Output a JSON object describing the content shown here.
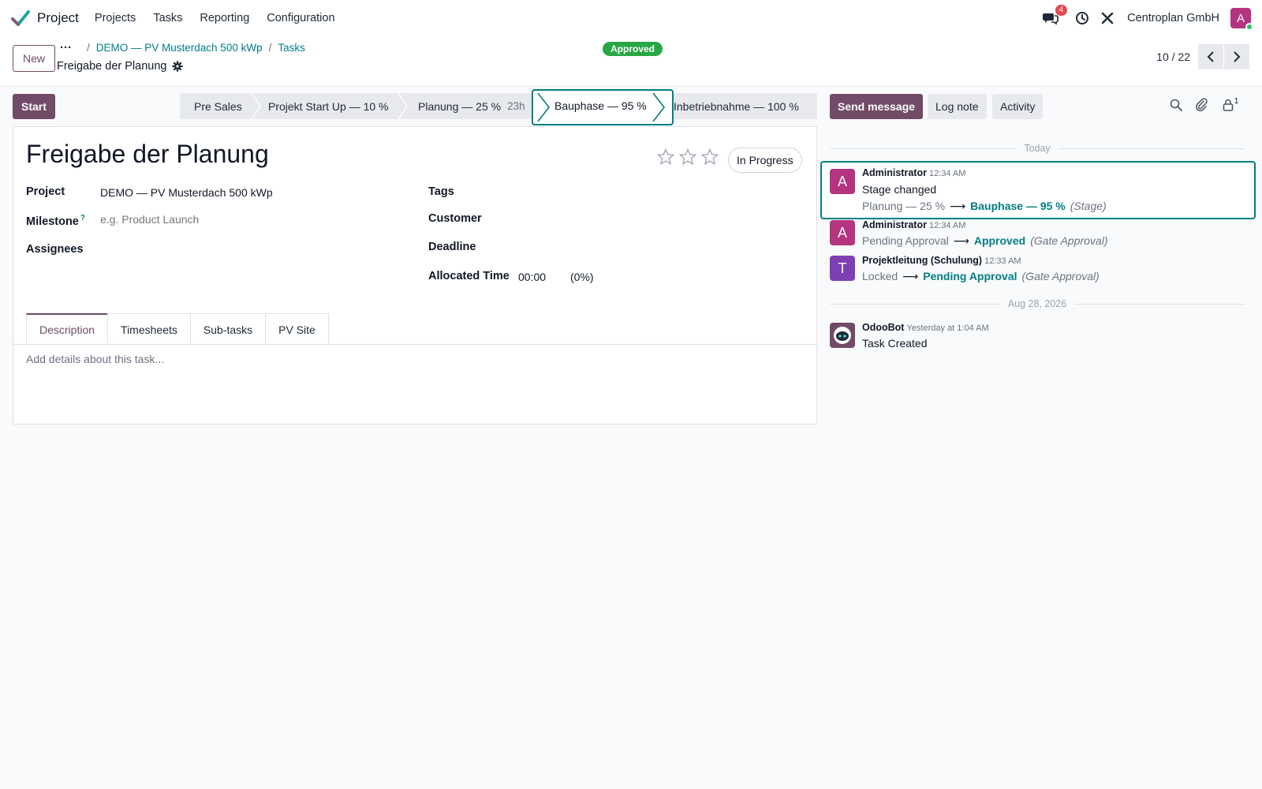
{
  "app": {
    "name": "Project",
    "menu": [
      "Projects",
      "Tasks",
      "Reporting",
      "Configuration"
    ],
    "company": "Centroplan GmbH",
    "user_initial": "A",
    "message_count": "4"
  },
  "control": {
    "new_label": "New",
    "dots": "···",
    "breadcrumb": [
      "DEMO — PV Musterdach 500 kWp",
      "Tasks"
    ],
    "record_title": "Freigabe der Planung",
    "approval_badge": "Approved",
    "pager": "10 / 22"
  },
  "statusbar": {
    "start_label": "Start",
    "stages": [
      {
        "label": "Pre Sales",
        "sub": ""
      },
      {
        "label": "Projekt Start Up — 10 %",
        "sub": ""
      },
      {
        "label": "Planung — 25 %",
        "sub": "23h"
      },
      {
        "label": "Bauphase — 95 %",
        "sub": ""
      },
      {
        "label": "Inbetriebnahme — 100 %",
        "sub": ""
      }
    ],
    "current_index": 3
  },
  "form": {
    "name": "Freigabe der Planung",
    "priority_stars": 3,
    "priority_filled": 0,
    "state": "In Progress",
    "fields": {
      "project_label": "Project",
      "project_value": "DEMO — PV Musterdach 500 kWp",
      "milestone_label": "Milestone",
      "milestone_help": "?",
      "milestone_placeholder": "e.g. Product Launch",
      "assignees_label": "Assignees",
      "tags_label": "Tags",
      "customer_label": "Customer",
      "deadline_label": "Deadline",
      "allocated_label": "Allocated Time",
      "allocated_value": "00:00",
      "allocated_percent": "(0%)"
    },
    "tabs": [
      "Description",
      "Timesheets",
      "Sub-tasks",
      "PV Site"
    ],
    "active_tab": 0,
    "description_placeholder": "Add details about this task..."
  },
  "chatter": {
    "send_label": "Send message",
    "log_label": "Log note",
    "activity_label": "Activity",
    "follower_count": "1",
    "dividers": [
      "Today",
      "Aug 28, 2026"
    ],
    "messages": [
      {
        "initial": "A",
        "author": "Administrator",
        "time": "12:34 AM",
        "body": "Stage changed",
        "old": "Planung — 25 %",
        "new": "Bauphase — 95 %",
        "field": "(Stage)",
        "color": "#b5347f"
      },
      {
        "initial": "A",
        "author": "Administrator",
        "time": "12:34 AM",
        "body": "",
        "old": "Pending Approval",
        "new": "Approved",
        "field": "(Gate Approval)",
        "color": "#b5347f"
      },
      {
        "initial": "T",
        "author": "Projektleitung (Schulung)",
        "time": "12:33 AM",
        "body": "",
        "old": "Locked",
        "new": "Pending Approval",
        "field": "(Gate Approval)",
        "color": "#7e3fb5"
      },
      {
        "initial": "",
        "author": "OdooBot",
        "time": "Yesterday at 1:04 AM",
        "body": "Task Created",
        "old": "",
        "new": "",
        "field": "",
        "color": "#714b67"
      }
    ]
  },
  "colors": {
    "primary": "#714b67",
    "accent": "#017e84",
    "success": "#28a745",
    "danger": "#e5484d"
  },
  "icons": [
    "check-logo-icon",
    "chat-icon",
    "clock-icon",
    "tools-icon",
    "gear-icon",
    "chevron-left-icon",
    "chevron-right-icon",
    "star-icon",
    "search-icon",
    "paperclip-icon",
    "lock-person-icon",
    "robot-avatar-icon"
  ]
}
